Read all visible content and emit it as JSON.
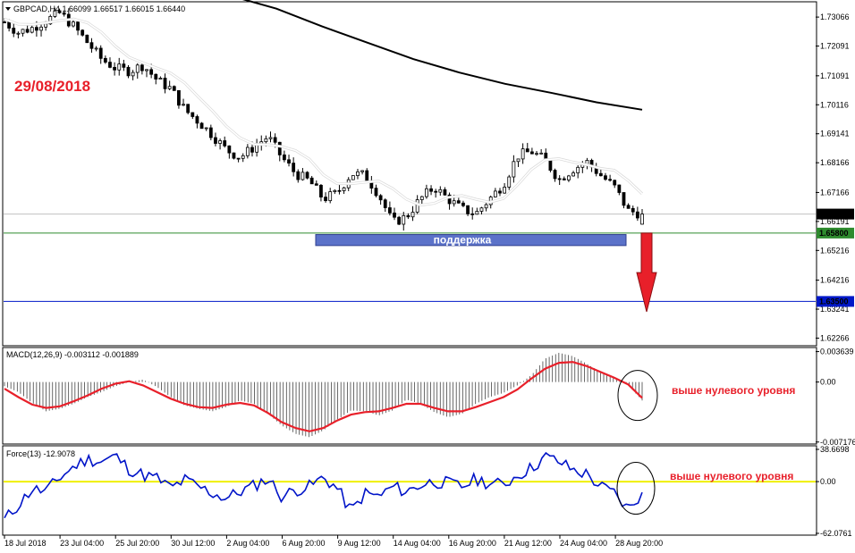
{
  "chart_data": {
    "type": "candlestick",
    "symbol_header": "GBPCAD,H4  1.66099 1.66517 1.66015 1.66440",
    "date_annotation": "29/08/2018",
    "support_label": "поддержка",
    "price_axis": {
      "ticks": [
        "1.73066",
        "1.72091",
        "1.71091",
        "1.70116",
        "1.69141",
        "1.68166",
        "1.67166",
        "1.66191",
        "1.65216",
        "1.64216",
        "1.63241",
        "1.62266"
      ],
      "range": [
        1.6204,
        1.7352
      ]
    },
    "price_tags": [
      {
        "label": "1.66440",
        "color": "#000000"
      },
      {
        "label": "1.65800",
        "color": "#2e8b2e"
      },
      {
        "label": "1.63500",
        "color": "#0018c8"
      }
    ],
    "levels": [
      {
        "value": 1.658,
        "color": "#2e8b2e"
      },
      {
        "value": 1.635,
        "color": "#0018c8"
      }
    ],
    "support_zone": {
      "from": 1.6575,
      "to": 1.6538,
      "start": "6 Aug 2018",
      "end": "28 Aug 2018"
    },
    "arrow": {
      "from": 1.658,
      "to": 1.6315,
      "color": "#e8202a"
    },
    "x_axis_labels": [
      "18 Jul 2018",
      "23 Jul 04:00",
      "25 Jul 20:00",
      "30 Jul 12:00",
      "2 Aug 04:00",
      "6 Aug 20:00",
      "9 Aug 12:00",
      "14 Aug 04:00",
      "16 Aug 20:00",
      "21 Aug 12:00",
      "24 Aug 04:00",
      "28 Aug 20:00"
    ],
    "close_trend": [
      1.729,
      1.7255,
      1.727,
      1.7295,
      1.732,
      1.7275,
      1.722,
      1.7165,
      1.7135,
      1.7125,
      1.7145,
      1.7095,
      1.7065,
      1.6995,
      1.6955,
      1.691,
      1.686,
      1.6835,
      1.687,
      1.6905,
      1.6835,
      1.678,
      1.6755,
      1.6695,
      1.6715,
      1.678,
      1.6775,
      1.671,
      1.6615,
      1.6635,
      1.6695,
      1.6735,
      1.6695,
      1.666,
      1.6645,
      1.6695,
      1.6745,
      1.684,
      1.6855,
      1.6825,
      1.676,
      1.6795,
      1.682,
      1.6775,
      1.6735,
      1.6655,
      1.6644
    ],
    "ma_fast": [
      {
        "x": 0.215,
        "y": 1.7295
      },
      {
        "x": 0.14,
        "y": 1.725
      },
      {
        "x": 0.19,
        "y": 1.7175
      },
      {
        "x": 0.26,
        "y": 1.711
      },
      {
        "x": 0.34,
        "y": 1.703
      },
      {
        "x": 0.41,
        "y": 1.695
      },
      {
        "x": 0.46,
        "y": 1.6865
      },
      {
        "x": 0.52,
        "y": 1.6825
      },
      {
        "x": 0.57,
        "y": 1.678
      },
      {
        "x": 0.64,
        "y": 1.674
      },
      {
        "x": 0.69,
        "y": 1.6705
      },
      {
        "x": 0.75,
        "y": 1.6725
      },
      {
        "x": 0.8,
        "y": 1.6715
      },
      {
        "x": 0.87,
        "y": 1.6718
      },
      {
        "x": 0.935,
        "y": 1.6775
      },
      {
        "x": 0.99,
        "y": 1.6805
      },
      {
        "x": 1.05,
        "y": 1.6755
      },
      {
        "x": 1.11,
        "y": 1.675
      },
      {
        "x": 1.16,
        "y": 1.6715
      }
    ],
    "ma_slow": [
      1.7378,
      1.7335,
      1.7275,
      1.722,
      1.7165,
      1.712,
      1.7082,
      1.7052,
      1.702,
      1.6995
    ],
    "macd": {
      "label": "MACD(12,26,9) -0.003112 -0.001889",
      "ticks": [
        "0.003639",
        "0.00",
        "-0.007176"
      ],
      "range": [
        -0.0072,
        0.0037
      ],
      "histogram": [
        -0.0005,
        -0.0012,
        -0.0025,
        -0.0035,
        -0.0032,
        -0.0026,
        -0.0018,
        -0.0012,
        -0.0005,
        0.0,
        0.0003,
        -0.0006,
        -0.0018,
        -0.0028,
        -0.0032,
        -0.0035,
        -0.003,
        -0.0022,
        -0.0026,
        -0.0038,
        -0.0052,
        -0.0062,
        -0.0066,
        -0.0058,
        -0.0045,
        -0.0034,
        -0.0035,
        -0.004,
        -0.0034,
        -0.0021,
        -0.0026,
        -0.0036,
        -0.0042,
        -0.0038,
        -0.0026,
        -0.0018,
        -0.0013,
        -0.0004,
        0.0008,
        0.0028,
        0.0035,
        0.0031,
        0.0022,
        0.0012,
        0.0006,
        -0.0004,
        -0.0022
      ],
      "signal": [
        -0.0008,
        -0.0018,
        -0.0027,
        -0.0031,
        -0.0029,
        -0.0023,
        -0.0016,
        -0.0008,
        -0.0002,
        0.0001,
        -0.0004,
        -0.0012,
        -0.002,
        -0.0026,
        -0.003,
        -0.0031,
        -0.0027,
        -0.0025,
        -0.0028,
        -0.0037,
        -0.0048,
        -0.0055,
        -0.0059,
        -0.0055,
        -0.0046,
        -0.0039,
        -0.0036,
        -0.0035,
        -0.0031,
        -0.0026,
        -0.0026,
        -0.0031,
        -0.0035,
        -0.0035,
        -0.003,
        -0.0024,
        -0.0018,
        -0.0009,
        0.0004,
        0.0016,
        0.0023,
        0.0024,
        0.0019,
        0.0012,
        0.0005,
        -0.0003,
        -0.0019
      ],
      "note": "выше нулевого уровня"
    },
    "force": {
      "label": "Force(13) -12.9078",
      "ticks": [
        "38.6698",
        "0.00",
        "-62.0761"
      ],
      "range": [
        -62.08,
        38.67
      ],
      "values": [
        -46,
        -28,
        -9,
        -12,
        5,
        18,
        27,
        24,
        31,
        15,
        8,
        4,
        -8,
        2,
        -6,
        -14,
        -20,
        -12,
        -5,
        4,
        -18,
        -10,
        -6,
        5,
        -8,
        -36,
        -14,
        -18,
        -6,
        -12,
        -4,
        0,
        -2,
        -6,
        3,
        -2,
        -4,
        8,
        16,
        30,
        24,
        14,
        9,
        -6,
        -14,
        -34,
        -13
      ]
    }
  }
}
